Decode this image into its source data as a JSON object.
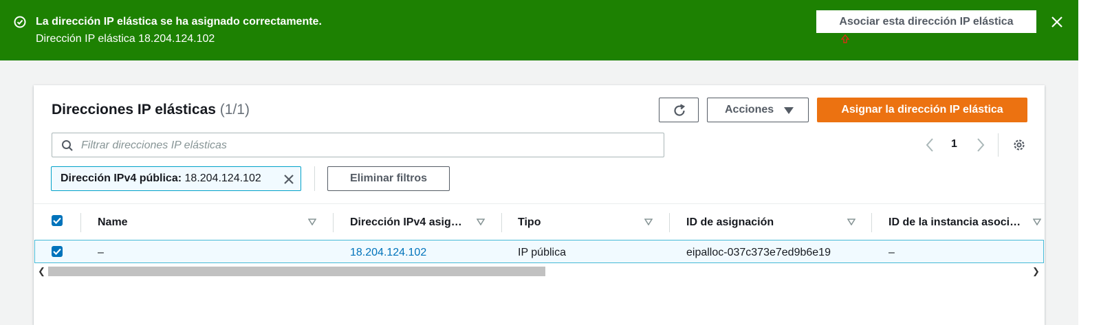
{
  "flash": {
    "title": "La dirección IP elástica se ha asignado correctamente.",
    "message": "Dirección IP elástica 18.204.124.102",
    "action_label": "Asociar esta dirección IP elástica",
    "color": "#1d8102"
  },
  "panel": {
    "title": "Direcciones IP elásticas",
    "count": "(1/1)",
    "actions_label": "Acciones",
    "assign_label": "Asignar la dirección IP elástica",
    "search_placeholder": "Filtrar direcciones IP elásticas",
    "page": "1",
    "filter_token": {
      "key": "Dirección IPv4 pública:",
      "value": "18.204.124.102"
    },
    "clear_filters_label": "Eliminar filtros"
  },
  "table": {
    "headers": [
      "Name",
      "Dirección IPv4 asig…",
      "Tipo",
      "ID de asignación",
      "ID de la instancia asoci…"
    ],
    "rows": [
      {
        "selected": true,
        "cells": [
          "–",
          "18.204.124.102",
          "IP pública",
          "eipalloc-037c373e7ed9b6e19",
          "–"
        ]
      }
    ]
  },
  "colors": {
    "accent": "#ec7211",
    "link": "#0073bb",
    "selected_row_border": "#44b9d6"
  }
}
